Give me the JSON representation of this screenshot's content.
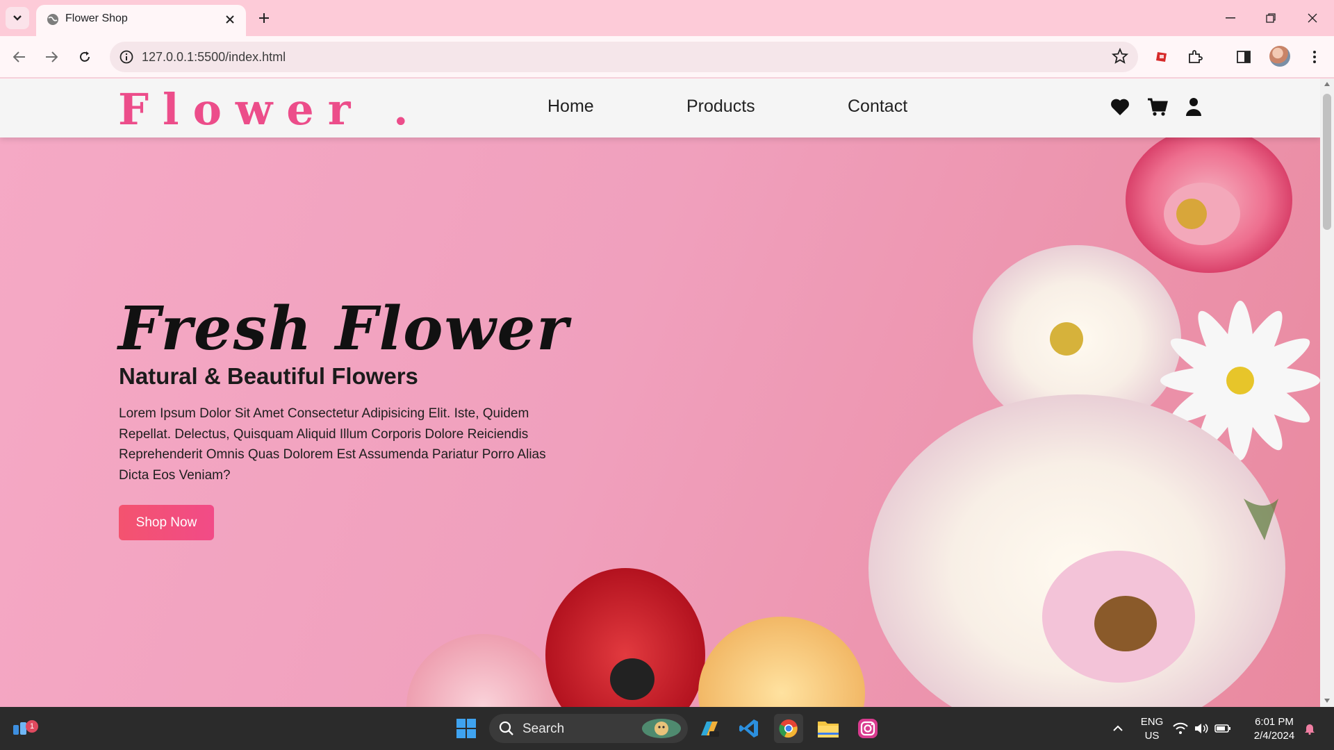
{
  "browser": {
    "tab_title": "Flower Shop",
    "url": "127.0.0.1:5500/index.html"
  },
  "site": {
    "logo": "Flower .",
    "nav": [
      "Home",
      "Products",
      "Contact"
    ],
    "header_icons": [
      "heart-icon",
      "cart-icon",
      "user-icon"
    ],
    "accent_color": "#ec4d8a"
  },
  "hero": {
    "title": "Fresh Flower",
    "subtitle": "Natural & Beautiful Flowers",
    "text": "Lorem Ipsum Dolor Sit Amet Consectetur Adipisicing Elit. Iste, Quidem Repellat. Delectus, Quisquam Aliquid Illum Corporis Dolore Reiciendis Reprehenderit Omnis Quas Dolorem Est Assumenda Pariatur Porro Alias Dicta Eos Veniam?",
    "button": "Shop Now",
    "button_color": "#f3536f"
  },
  "taskbar": {
    "search_label": "Search",
    "notification_count": "1",
    "language": "ENG",
    "region": "US",
    "time": "6:01 PM",
    "date": "2/4/2024"
  }
}
